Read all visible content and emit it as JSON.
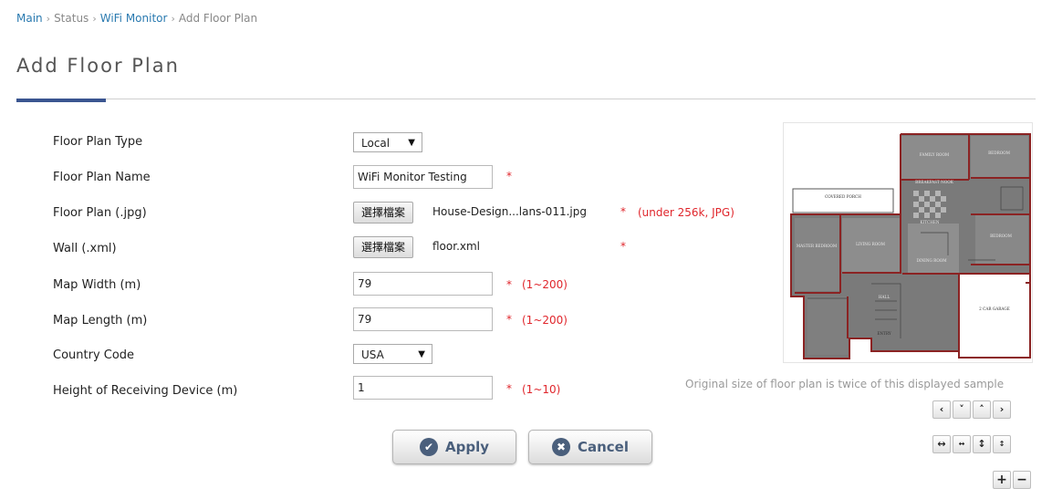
{
  "breadcrumb": {
    "items": [
      "Main",
      "Status",
      "WiFi Monitor",
      "Add Floor Plan"
    ],
    "separator": "›"
  },
  "page_title": "Add Floor Plan",
  "form": {
    "floor_plan_type": {
      "label": "Floor Plan Type",
      "value": "Local"
    },
    "floor_plan_name": {
      "label": "Floor Plan Name",
      "value": "WiFi Monitor Testing",
      "required": "*"
    },
    "floor_plan_jpg": {
      "label": "Floor Plan (.jpg)",
      "button": "選擇檔案",
      "file": "House-Design...lans-011.jpg",
      "required": "*",
      "hint": "(under 256k, JPG)"
    },
    "wall_xml": {
      "label": "Wall (.xml)",
      "button": "選擇檔案",
      "file": "floor.xml",
      "required": "*"
    },
    "map_width": {
      "label": "Map Width (m)",
      "value": "79",
      "required": "*",
      "hint": "(1~200)"
    },
    "map_length": {
      "label": "Map Length (m)",
      "value": "79",
      "required": "*",
      "hint": "(1~200)"
    },
    "country_code": {
      "label": "Country Code",
      "value": "USA"
    },
    "device_height": {
      "label": "Height of Receiving Device (m)",
      "value": "1",
      "required": "*",
      "hint": "(1~10)"
    }
  },
  "actions": {
    "apply": "Apply",
    "cancel": "Cancel"
  },
  "preview": {
    "caption": "Original size of floor plan is twice of this displayed sample",
    "nav": {
      "left": "‹",
      "down": "˅",
      "up": "˄",
      "right": "›",
      "widen": "↔",
      "narrow": "↔",
      "taller": "↕",
      "shorter": "↕",
      "zoom_in": "+",
      "zoom_out": "−"
    },
    "room_labels": [
      "COVERED PORCH",
      "FAMILY ROOM",
      "BEDROOM",
      "BREAKFAST NOOK",
      "KITCHEN",
      "MASTER BEDROOM",
      "LIVING ROOM",
      "DINING ROOM",
      "2 CAR GARAGE",
      "ENTRY",
      "HALL",
      "BEDROOM"
    ]
  },
  "colors": {
    "link": "#2a7ab0",
    "accent": "#3a5590",
    "required": "#e0262c",
    "button_text": "#4a5f7c",
    "wall": "#8b2323"
  }
}
